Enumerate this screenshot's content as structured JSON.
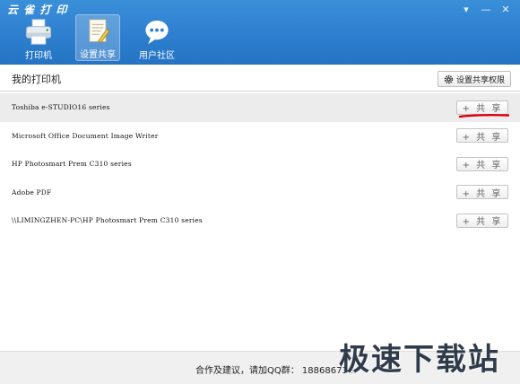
{
  "window": {
    "title": "云 雀 打 印",
    "controls": [
      "▾",
      "—",
      "✕"
    ]
  },
  "tabs": [
    {
      "label": "打印机",
      "icon": "printer-icon",
      "active": false
    },
    {
      "label": "设置共享",
      "icon": "settings-share-icon",
      "active": true
    },
    {
      "label": "用户社区",
      "icon": "chat-bubble-icon",
      "active": false
    }
  ],
  "section": {
    "title": "我的打印机",
    "permission_button": "设置共享权限"
  },
  "printers": [
    {
      "name": "Toshiba e-STUDIO16 series",
      "share_label": "+ 共 享",
      "selected": true
    },
    {
      "name": "Microsoft Office Document Image Writer",
      "share_label": "+ 共 享",
      "selected": false
    },
    {
      "name": "HP Photosmart Prem C310 series",
      "share_label": "+ 共 享",
      "selected": false
    },
    {
      "name": "Adobe PDF",
      "share_label": "+ 共 享",
      "selected": false
    },
    {
      "name": "\\\\LIMINGZHEN-PC\\HP Photosmart Prem C310 series",
      "share_label": "+ 共 享",
      "selected": false
    }
  ],
  "footer": {
    "text": "合作及建议，请加QQ群： 188686734"
  },
  "watermark": "极速下载站",
  "colors": {
    "header": "#2e7fcf",
    "annotation": "#e0000f"
  }
}
